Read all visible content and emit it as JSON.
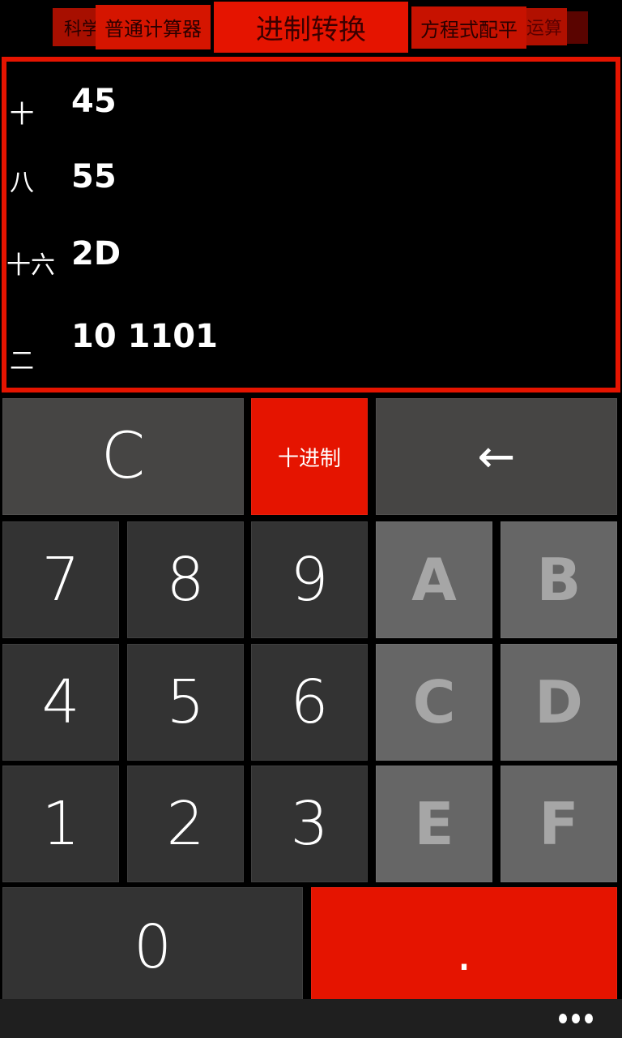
{
  "pivot": {
    "tabs": [
      {
        "id": "scientific",
        "label": "科学"
      },
      {
        "id": "standard",
        "label": "普通计算器"
      },
      {
        "id": "base-conversion",
        "label": "进制转换",
        "active": true
      },
      {
        "id": "equation-balance",
        "label": "方程式配平"
      },
      {
        "id": "equation-solve",
        "label": "方程运算"
      }
    ]
  },
  "display": {
    "rows": [
      {
        "base": "decimal",
        "label": "十",
        "value": "45"
      },
      {
        "base": "octal",
        "label": "八",
        "value": "55"
      },
      {
        "base": "hexadecimal",
        "label": "十六",
        "value": "2D"
      },
      {
        "base": "binary",
        "label": "二",
        "value": "10 1101"
      }
    ]
  },
  "keypad": {
    "clear": "C",
    "mode": "十进制",
    "backspace": "←",
    "digits": {
      "d7": "7",
      "d8": "8",
      "d9": "9",
      "d4": "4",
      "d5": "5",
      "d6": "6",
      "d1": "1",
      "d2": "2",
      "d3": "3",
      "d0": "0"
    },
    "hex": {
      "A": "A",
      "B": "B",
      "C": "C",
      "D": "D",
      "E": "E",
      "F": "F"
    },
    "dot": "."
  },
  "colors": {
    "accent": "#e51400",
    "key_top": "#464544",
    "key_digit": "#333333",
    "key_hex_disabled": "#666666",
    "appbar": "#1f1f1f"
  },
  "appbar": {
    "more_icon": "ellipsis-icon"
  }
}
